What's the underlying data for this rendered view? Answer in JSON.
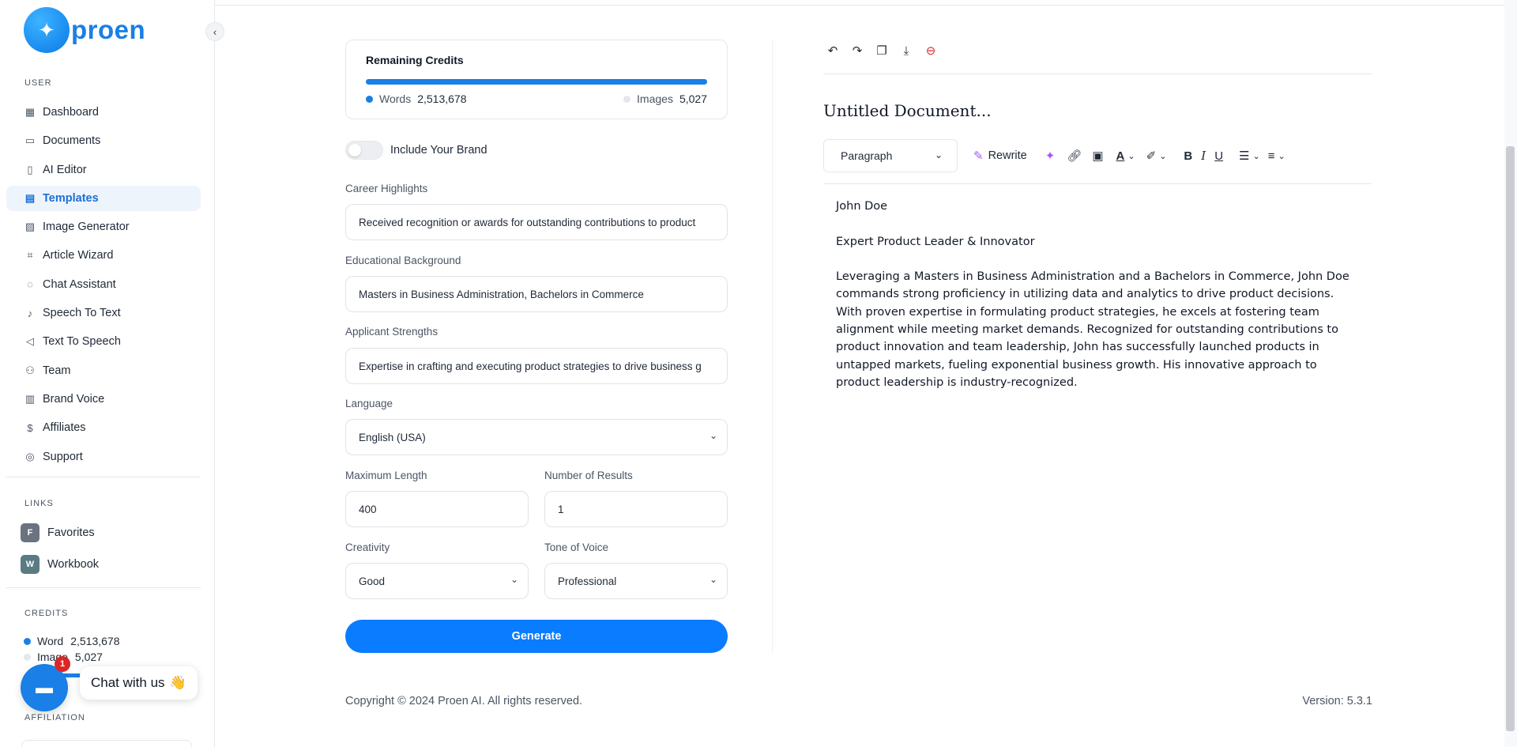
{
  "brand": {
    "name": "proen",
    "accent": "#1a7fe6"
  },
  "sidebar": {
    "user_label": "USER",
    "items": [
      {
        "label": "Dashboard",
        "icon": "grid-icon"
      },
      {
        "label": "Documents",
        "icon": "archive-icon"
      },
      {
        "label": "AI Editor",
        "icon": "book-icon"
      },
      {
        "label": "Templates",
        "icon": "file-text-icon",
        "active": true
      },
      {
        "label": "Image Generator",
        "icon": "image-icon"
      },
      {
        "label": "Article Wizard",
        "icon": "wand-icon"
      },
      {
        "label": "Chat Assistant",
        "icon": "chat-bubble-icon"
      },
      {
        "label": "Speech To Text",
        "icon": "microphone-icon"
      },
      {
        "label": "Text To Speech",
        "icon": "speaker-icon"
      },
      {
        "label": "Team",
        "icon": "user-plus-icon"
      },
      {
        "label": "Brand Voice",
        "icon": "layout-icon"
      },
      {
        "label": "Affiliates",
        "icon": "dollar-icon"
      },
      {
        "label": "Support",
        "icon": "lifebuoy-icon"
      }
    ],
    "links_label": "LINKS",
    "links": [
      {
        "badge": "F",
        "label": "Favorites",
        "color": "#6b7280"
      },
      {
        "badge": "W",
        "label": "Workbook",
        "color": "#5b7b83"
      }
    ],
    "credits_label": "CREDITS",
    "credits": {
      "word_label": "Word",
      "word_value": "2,513,678",
      "image_label": "Image",
      "image_value": "5,027"
    },
    "affiliation_label": "AFFILIATION"
  },
  "chat": {
    "badge": "1",
    "label": "Chat with us",
    "emoji": "👋"
  },
  "remaining_credits": {
    "title": "Remaining Credits",
    "words_label": "Words",
    "words_value": "2,513,678",
    "images_label": "Images",
    "images_value": "5,027",
    "progress": 0.998
  },
  "form": {
    "brand_toggle_label": "Include Your Brand",
    "brand_toggle_on": false,
    "career_label": "Career Highlights",
    "career_value": "Received recognition or awards for outstanding contributions to product",
    "education_label": "Educational Background",
    "education_value": "Masters in Business Administration, Bachelors in Commerce",
    "strengths_label": "Applicant Strengths",
    "strengths_value": "Expertise in crafting and executing product strategies to drive business g",
    "language_label": "Language",
    "language_value": "English (USA)",
    "max_length_label": "Maximum Length",
    "max_length_value": "400",
    "results_label": "Number of Results",
    "results_value": "1",
    "creativity_label": "Creativity",
    "creativity_value": "Good",
    "tone_label": "Tone of Voice",
    "tone_value": "Professional",
    "generate_label": "Generate"
  },
  "editor": {
    "title": "Untitled Document...",
    "paragraph_select": "Paragraph",
    "rewrite_label": "Rewrite",
    "body": [
      "John Doe",
      "Expert Product Leader & Innovator",
      "Leveraging a Masters in Business Administration and a Bachelors in Commerce, John Doe commands strong proficiency in utilizing data and analytics to drive product decisions. With proven expertise in formulating product strategies, he excels at fostering team alignment while meeting market demands. Recognized for outstanding contributions to product innovation and team leadership, John has successfully launched products in untapped markets, fueling exponential business growth. His innovative approach to product leadership is industry-recognized."
    ]
  },
  "footer": {
    "copyright": "Copyright © 2024 Proen AI. All rights reserved.",
    "version": "Version: 5.3.1"
  }
}
